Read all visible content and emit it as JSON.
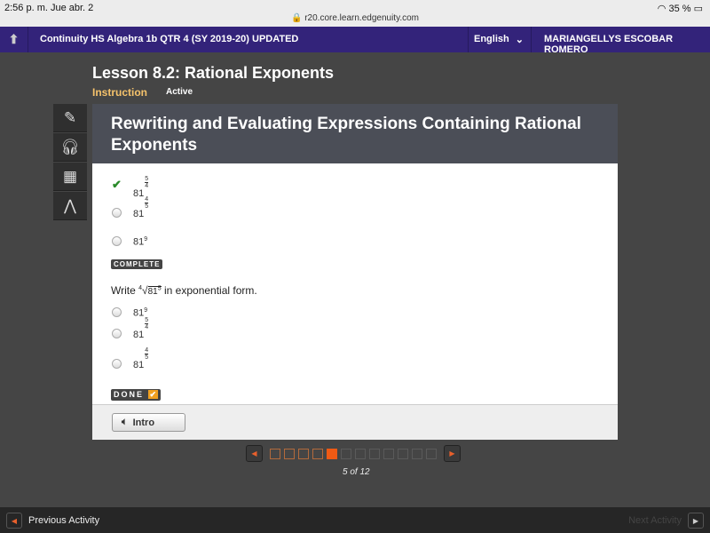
{
  "status": {
    "time": "2:56 p. m.   Jue abr. 2",
    "url": "r20.core.learn.edgenuity.com",
    "battery": "35 %"
  },
  "nav": {
    "course": "Continuity HS Algebra 1b QTR 4 (SY 2019-20) UPDATED",
    "language": "English",
    "user": "MARIANGELLYS ESCOBAR ROMERO"
  },
  "lesson": {
    "title": "Lesson 8.2: Rational Exponents",
    "tab_instruction": "Instruction",
    "tab_active": "Active"
  },
  "tools": [
    "pencil-icon",
    "headphones-icon",
    "calculator-icon",
    "reference-icon"
  ],
  "panel": {
    "title": "Rewriting and Evaluating Expressions Containing Rational Exponents",
    "q1_options": [
      {
        "base": "81",
        "num": "5",
        "den": "4",
        "state": "checked"
      },
      {
        "base": "81",
        "num": "4",
        "den": "5",
        "state": "unselected"
      },
      {
        "base": "81",
        "exp": "9",
        "state": "unselected"
      }
    ],
    "q1_badge": "COMPLETE",
    "q2": {
      "prefix": "Write",
      "root_index": "4",
      "radicand": "81",
      "radicand_exp": "5",
      "suffix": "in exponential form."
    },
    "q2_options": [
      {
        "base": "81",
        "exp": "9"
      },
      {
        "base": "81",
        "num": "5",
        "den": "4"
      },
      {
        "base": "81",
        "num": "4",
        "den": "5"
      }
    ],
    "q2_badge": "DONE",
    "intro_label": "Intro"
  },
  "pager": {
    "current": 5,
    "total": 12,
    "label": "5 of 12"
  },
  "bottom": {
    "prev": "Previous Activity",
    "next": "Next Activity"
  },
  "colors": {
    "nav": "#33237a",
    "accent": "#f05a14",
    "check": "#2a8a2a"
  }
}
